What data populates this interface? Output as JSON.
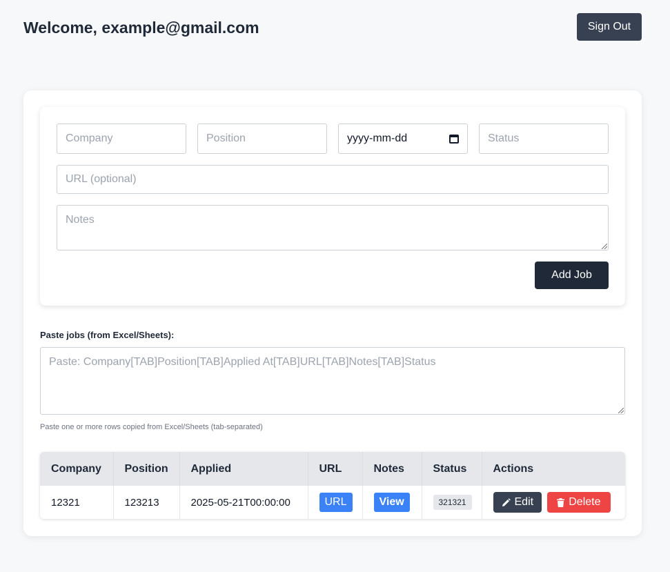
{
  "header": {
    "welcome": "Welcome, example@gmail.com",
    "sign_out": "Sign Out"
  },
  "form": {
    "company_placeholder": "Company",
    "position_placeholder": "Position",
    "date_placeholder": "yyyy-mm-dd",
    "status_placeholder": "Status",
    "url_placeholder": "URL (optional)",
    "notes_placeholder": "Notes",
    "add_job": "Add Job"
  },
  "paste": {
    "label": "Paste jobs (from Excel/Sheets):",
    "placeholder": "Paste: Company[TAB]Position[TAB]Applied At[TAB]URL[TAB]Notes[TAB]Status",
    "hint": "Paste one or more rows copied from Excel/Sheets (tab-separated)"
  },
  "table": {
    "headers": [
      "Company",
      "Position",
      "Applied",
      "URL",
      "Notes",
      "Status",
      "Actions"
    ],
    "rows": [
      {
        "company": "12321",
        "position": "123213",
        "applied": "2025-05-21T00:00:00",
        "url_label": "URL",
        "notes_label": "View",
        "status": "321321",
        "edit_label": "Edit",
        "delete_label": "Delete"
      }
    ]
  },
  "colors": {
    "primary_dark": "#1f2937",
    "button_gray": "#374151",
    "link_blue": "#3b82f6",
    "danger_red": "#ef4444"
  }
}
